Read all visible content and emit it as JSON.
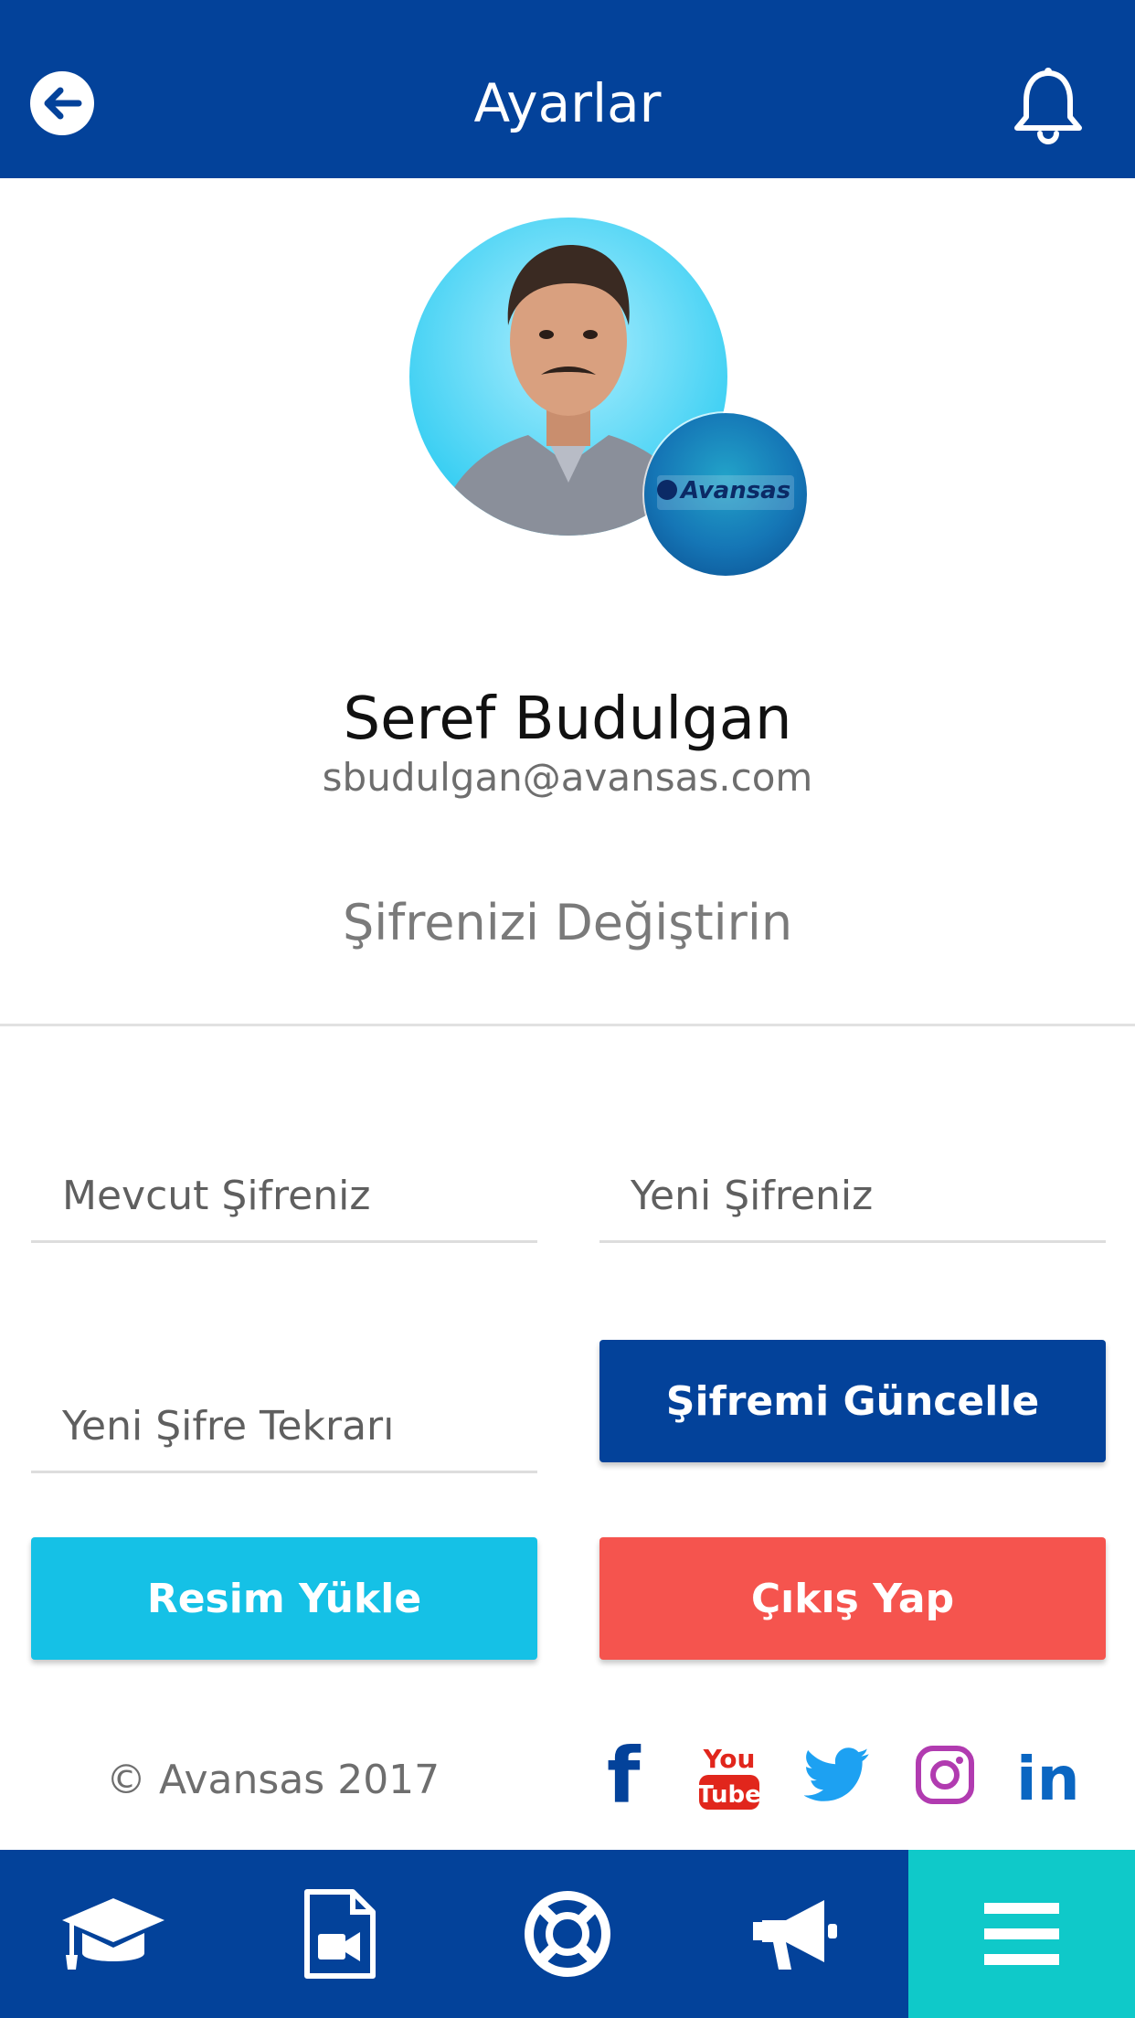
{
  "header": {
    "title": "Ayarlar",
    "back_icon": "arrow-left-circle-icon",
    "notification_icon": "bell-icon"
  },
  "profile": {
    "name": "Seref Budulgan",
    "email": "sbudulgan@avansas.com",
    "avatar": "user-photo",
    "brand_badge_text": "Avansas"
  },
  "password_section": {
    "title": "Şifrenizi Değiştirin",
    "current_password_placeholder": "Mevcut Şifreniz",
    "new_password_placeholder": "Yeni Şifreniz",
    "repeat_password_placeholder": "Yeni Şifre Tekrarı",
    "update_button": "Şifremi Güncelle"
  },
  "actions": {
    "upload_photo_button": "Resim Yükle",
    "logout_button": "Çıkış Yap"
  },
  "footer": {
    "copyright": "© Avansas 2017",
    "social": [
      {
        "name": "facebook",
        "icon": "facebook-icon",
        "color": "#03429a",
        "label": "f"
      },
      {
        "name": "youtube",
        "icon": "youtube-icon",
        "color": "#e1261c",
        "label_top": "You",
        "label_bottom": "Tube"
      },
      {
        "name": "twitter",
        "icon": "twitter-icon",
        "color": "#1da1f2"
      },
      {
        "name": "instagram",
        "icon": "instagram-icon",
        "color": "#c13584"
      },
      {
        "name": "linkedin",
        "icon": "linkedin-icon",
        "color": "#0a66c2",
        "label": "in"
      }
    ]
  },
  "bottom_nav": {
    "items": [
      {
        "icon": "graduation-cap-icon",
        "active": false
      },
      {
        "icon": "video-file-icon",
        "active": false
      },
      {
        "icon": "lifebuoy-icon",
        "active": false
      },
      {
        "icon": "megaphone-icon",
        "active": false
      },
      {
        "icon": "menu-icon",
        "active": true
      }
    ]
  },
  "colors": {
    "primary": "#03429a",
    "accent_cyan": "#15c1e6",
    "danger": "#f5544e",
    "active_tab": "#0fc9c9"
  }
}
